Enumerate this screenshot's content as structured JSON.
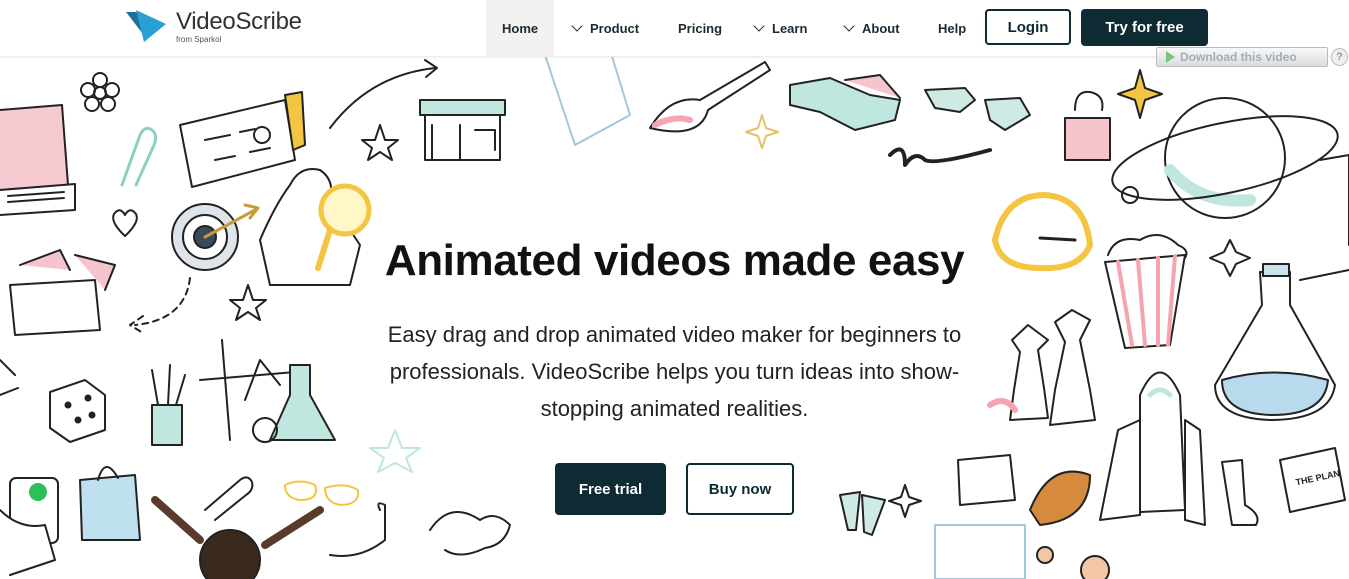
{
  "brand": {
    "name": "VideoScribe",
    "sub": "from Sparkol"
  },
  "nav": {
    "home": "Home",
    "product": "Product",
    "pricing": "Pricing",
    "learn": "Learn",
    "about": "About",
    "help": "Help",
    "login": "Login",
    "try": "Try for free"
  },
  "download": {
    "label": "Download this video",
    "help": "?"
  },
  "hero": {
    "title": "Animated videos made easy",
    "subtitle": "Easy drag and drop animated video maker for beginners to professionals. VideoScribe helps you turn ideas into show-stopping animated realities.",
    "trial": "Free trial",
    "buy": "Buy now"
  },
  "doodle_labels": {
    "book": "THE PLAN"
  },
  "colors": {
    "accent": "#0e2a33",
    "logo_blue": "#2aa1d5",
    "mint": "#bfe6df",
    "pink": "#f5c4cc",
    "yellow": "#f4c542"
  }
}
